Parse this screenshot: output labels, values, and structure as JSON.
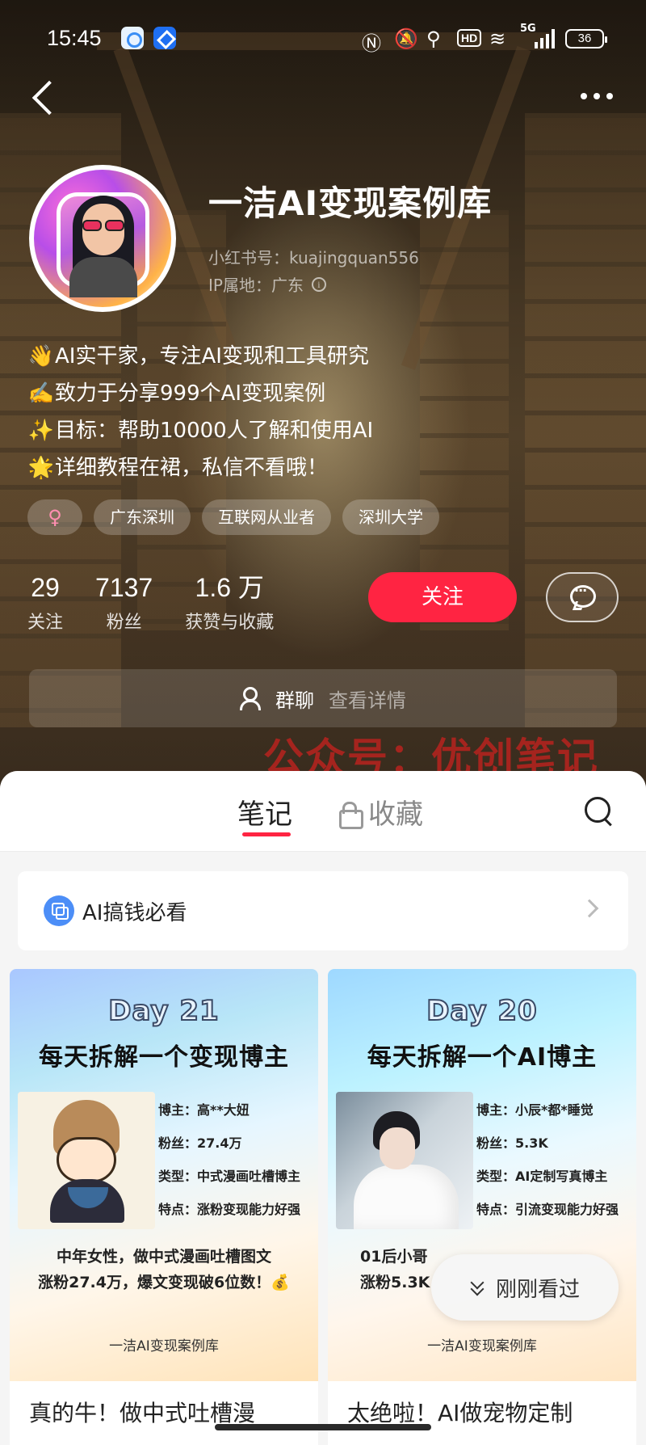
{
  "status_bar": {
    "time": "15:45",
    "signal": "5G",
    "hd": "HD",
    "battery": "36"
  },
  "profile": {
    "name": "一洁AI变现案例库",
    "redbook_id": "小红书号：kuajingquan556",
    "ip_location": "IP属地：广东",
    "bio": [
      {
        "emoji": "👋",
        "text": "AI实干家，专注AI变现和工具研究"
      },
      {
        "emoji": "✍️",
        "text": "致力于分享999个AI变现案例"
      },
      {
        "emoji": "✨",
        "text": "目标：帮助10000人了解和使用AI"
      },
      {
        "emoji": "🌟",
        "text": "详细教程在裙，私信不看哦！"
      }
    ],
    "tags": {
      "gender": "♀",
      "items": [
        "广东深圳",
        "互联网从业者",
        "深圳大学"
      ]
    },
    "stats": [
      {
        "value": "29",
        "label": "关注"
      },
      {
        "value": "7137",
        "label": "粉丝"
      },
      {
        "value": "1.6 万",
        "label": "获赞与收藏"
      }
    ],
    "follow_label": "关注",
    "group_chat": {
      "label": "群聊",
      "action": "查看详情"
    }
  },
  "watermark": "公众号：优创笔记",
  "tabs": {
    "notes": "笔记",
    "favorites": "收藏"
  },
  "collection": {
    "label": "AI搞钱必看"
  },
  "notes": [
    {
      "day": "Day 21",
      "headline": "每天拆解一个变现博主",
      "facts": [
        "博主：高**大妞",
        "粉丝：27.4万",
        "类型：中式漫画吐槽博主",
        "特点：涨粉变现能力好强"
      ],
      "summary_lines": [
        "中年女性，做中式漫画吐槽图文",
        "涨粉27.4万，爆文变现破6位数！💰"
      ],
      "brand": "一洁AI变现案例库",
      "title": "真的牛！做中式吐槽漫"
    },
    {
      "day": "Day 20",
      "headline": "每天拆解一个AI博主",
      "facts": [
        "博主：小辰*都*睡觉",
        "粉丝：5.3K",
        "类型：AI定制写真博主",
        "特点：引流变现能力好强"
      ],
      "summary_lines": [
        "01后小哥",
        "涨粉5.3K"
      ],
      "brand": "一洁AI变现案例库",
      "title": "太绝啦！AI做宠物定制"
    }
  ],
  "recently_viewed": "刚刚看过",
  "colors": {
    "accent": "#ff2442",
    "watermark": "#e61e1e",
    "collection_icon": "#4c8ef7"
  }
}
